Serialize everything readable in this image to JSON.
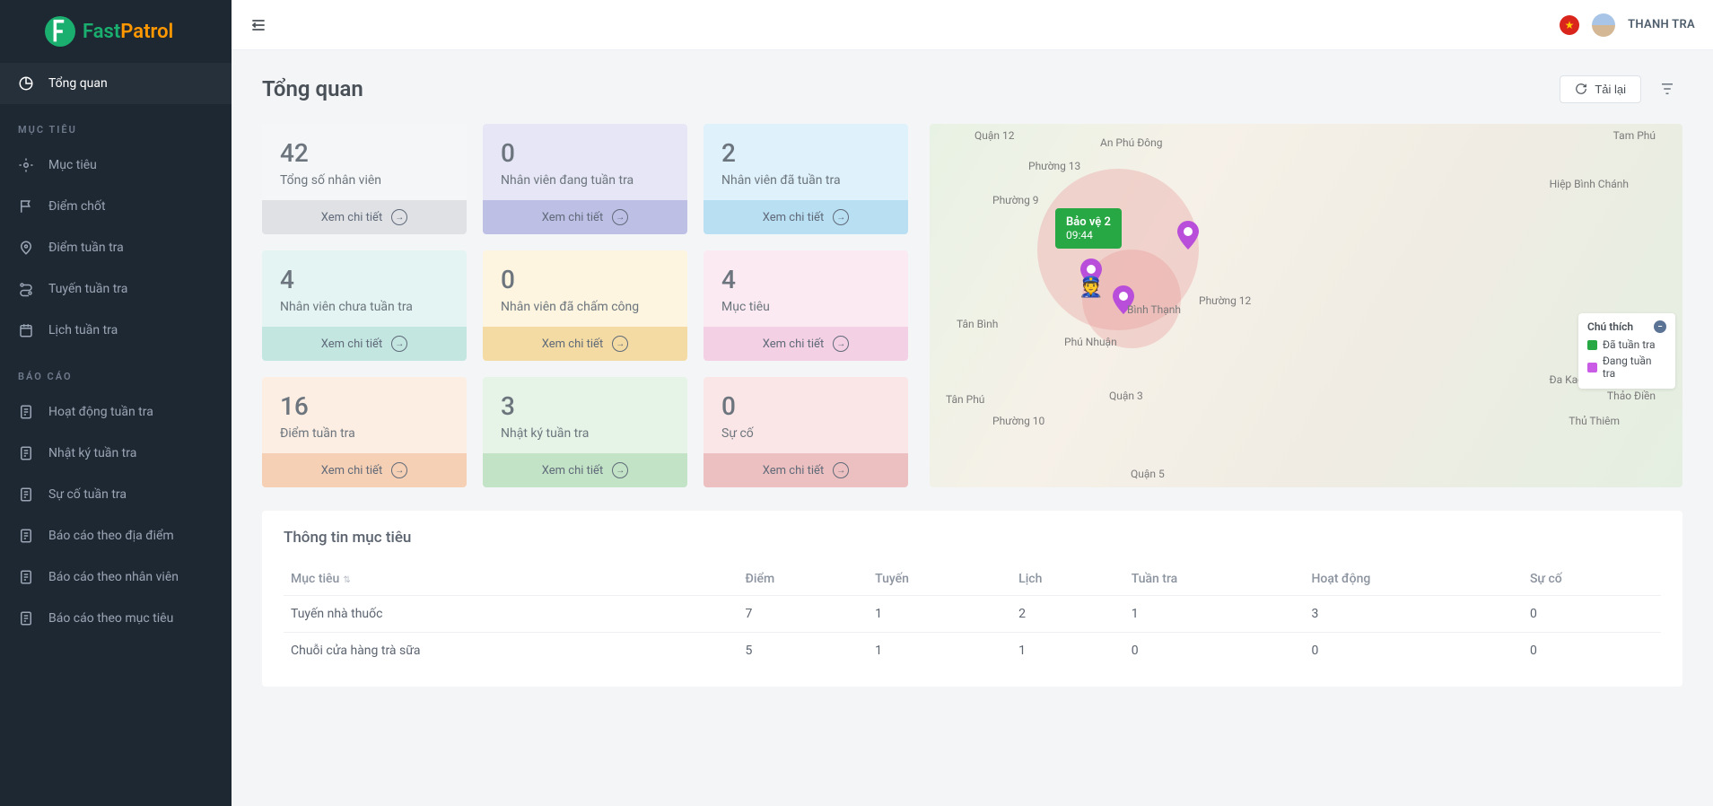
{
  "brand": {
    "fast": "Fast",
    "patrol": "Patrol"
  },
  "user": {
    "name": "THANH TRA"
  },
  "sidebar": {
    "items": [
      {
        "label": "Tổng quan",
        "icon": "pie-icon"
      }
    ],
    "sections": [
      {
        "title": "MỤC TIÊU",
        "items": [
          {
            "label": "Mục tiêu",
            "icon": "target-icon"
          },
          {
            "label": "Điểm chốt",
            "icon": "flag-icon"
          },
          {
            "label": "Điểm tuần tra",
            "icon": "pin-icon"
          },
          {
            "label": "Tuyến tuần tra",
            "icon": "route-icon"
          },
          {
            "label": "Lịch tuần tra",
            "icon": "calendar-icon"
          }
        ]
      },
      {
        "title": "BÁO CÁO",
        "items": [
          {
            "label": "Hoạt động tuần tra",
            "icon": "report-icon"
          },
          {
            "label": "Nhật ký tuần tra",
            "icon": "report-icon"
          },
          {
            "label": "Sự cố tuần tra",
            "icon": "report-icon"
          },
          {
            "label": "Báo cáo theo địa điểm",
            "icon": "report-icon"
          },
          {
            "label": "Báo cáo theo nhân viên",
            "icon": "report-icon"
          },
          {
            "label": "Báo cáo theo mục tiêu",
            "icon": "report-icon"
          }
        ]
      }
    ]
  },
  "page": {
    "title": "Tổng quan",
    "reload": "Tải lại"
  },
  "cards": [
    {
      "value": "42",
      "label": "Tổng số nhân viên",
      "cta": "Xem chi tiết",
      "cls": "c-gray"
    },
    {
      "value": "0",
      "label": "Nhân viên đang tuần tra",
      "cta": "Xem chi tiết",
      "cls": "c-purple"
    },
    {
      "value": "2",
      "label": "Nhân viên đã tuần tra",
      "cta": "Xem chi tiết",
      "cls": "c-blue"
    },
    {
      "value": "4",
      "label": "Nhân viên chưa tuần tra",
      "cta": "Xem chi tiết",
      "cls": "c-teal"
    },
    {
      "value": "0",
      "label": "Nhân viên đã chấm công",
      "cta": "Xem chi tiết",
      "cls": "c-yellow"
    },
    {
      "value": "4",
      "label": "Mục tiêu",
      "cta": "Xem chi tiết",
      "cls": "c-pink"
    },
    {
      "value": "16",
      "label": "Điểm tuần tra",
      "cta": "Xem chi tiết",
      "cls": "c-orange"
    },
    {
      "value": "3",
      "label": "Nhật ký tuần tra",
      "cta": "Xem chi tiết",
      "cls": "c-green"
    },
    {
      "value": "0",
      "label": "Sự cố",
      "cta": "Xem chi tiết",
      "cls": "c-red"
    }
  ],
  "map": {
    "tooltip_name": "Bảo vệ 2",
    "tooltip_time": "09:44",
    "legend_title": "Chú thích",
    "legend_done": "Đã tuần tra",
    "legend_doing": "Đang tuần tra",
    "labels": [
      "Quận 12",
      "An Phú Đông",
      "Tam Phú",
      "Phường 13",
      "Hiệp Bình Chánh",
      "Phường 9",
      "Bình Thạnh",
      "Phú Nhuận",
      "Tân Bình",
      "Tân Phú",
      "Quận 3",
      "Quận 5",
      "Phường 10",
      "Thảo Điền",
      "Đa Kao",
      "Thủ Thiêm",
      "Phường 12"
    ]
  },
  "table": {
    "title": "Thông tin mục tiêu",
    "columns": [
      "Mục tiêu",
      "Điểm",
      "Tuyến",
      "Lịch",
      "Tuần tra",
      "Hoạt động",
      "Sự cố"
    ],
    "rows": [
      {
        "name": "Tuyến nhà thuốc",
        "diem": "7",
        "tuyen": "1",
        "lich": "2",
        "tuantra": "1",
        "hoatdong": "3",
        "suco": "0"
      },
      {
        "name": "Chuỗi cửa hàng trà sữa",
        "diem": "5",
        "tuyen": "1",
        "lich": "1",
        "tuantra": "0",
        "hoatdong": "0",
        "suco": "0"
      }
    ]
  }
}
